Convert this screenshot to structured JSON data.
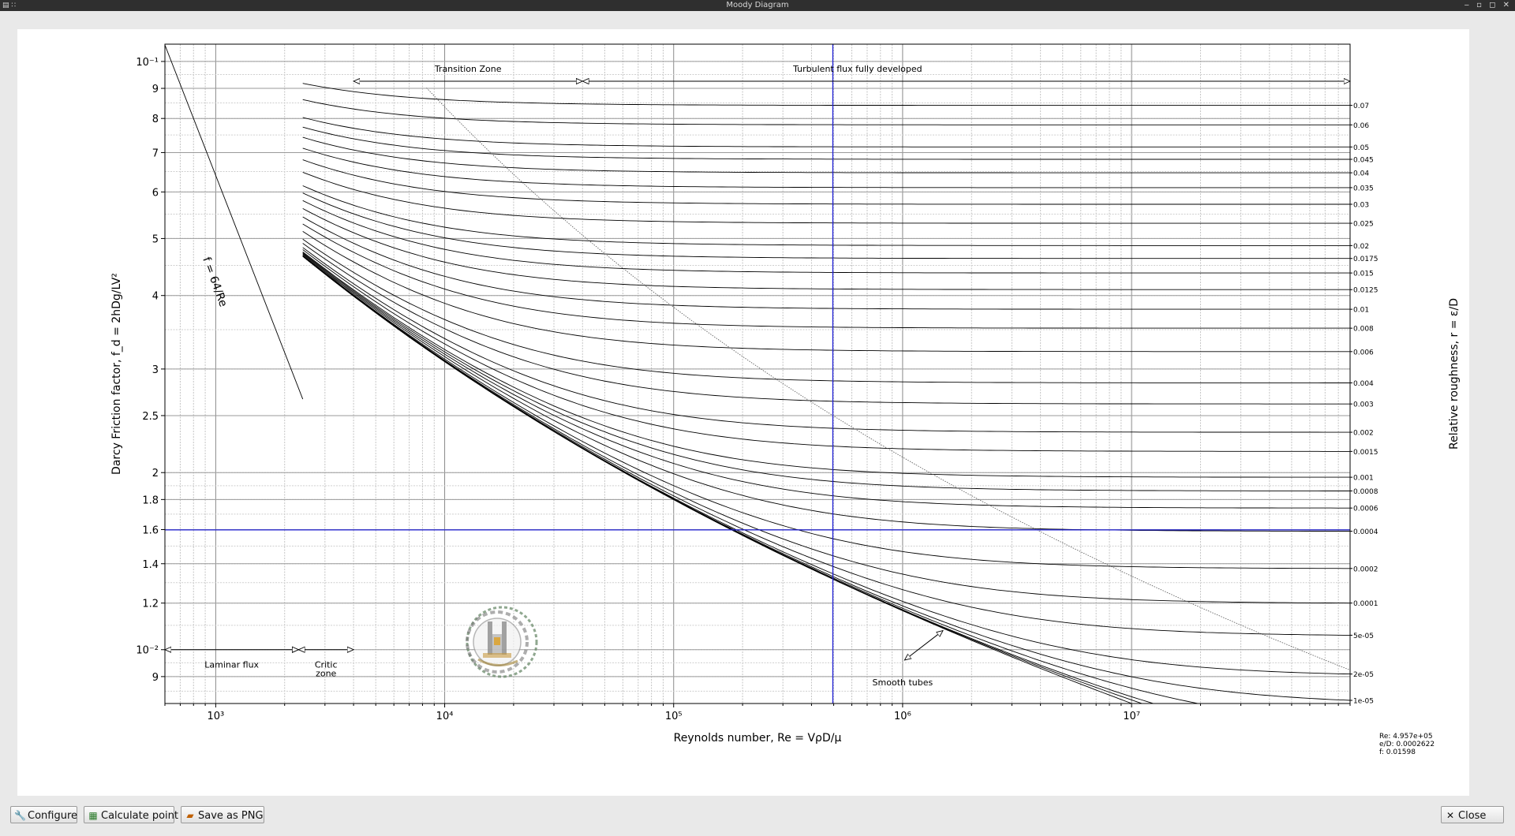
{
  "window": {
    "title": "Moody Diagram"
  },
  "toolbar": {
    "configure_label": "Configure",
    "calculate_label": "Calculate point",
    "save_label": "Save as PNG",
    "close_label": "Close",
    "icons": [
      "wrench-icon",
      "calculator-icon",
      "save-icon",
      "close-icon"
    ]
  },
  "readout": {
    "re": "Re: 4.957e+05",
    "ed": "e/D: 0.0002622",
    "f": "f: 0.01598"
  },
  "chart_data": {
    "type": "line",
    "scale": {
      "x": "log",
      "y": "log"
    },
    "xlim": [
      600,
      90000000
    ],
    "ylim": [
      0.0081,
      0.107
    ],
    "grid": true,
    "xlabel": "Reynolds number, Re = VρD/μ",
    "ylabel": "Darcy Friction factor,  f_d = 2hDg/LV²",
    "y2label": "Relative roughness, r = ε/D",
    "x_ticks": [
      "10³",
      "10⁴",
      "10⁵",
      "10⁶",
      "10⁷"
    ],
    "y_ticks": [
      {
        "v": 0.1,
        "label": "10⁻¹"
      },
      {
        "v": 0.09,
        "label": "9"
      },
      {
        "v": 0.08,
        "label": "8"
      },
      {
        "v": 0.07,
        "label": "7"
      },
      {
        "v": 0.06,
        "label": "6"
      },
      {
        "v": 0.05,
        "label": "5"
      },
      {
        "v": 0.04,
        "label": "4"
      },
      {
        "v": 0.03,
        "label": "3"
      },
      {
        "v": 0.025,
        "label": "2.5"
      },
      {
        "v": 0.02,
        "label": "2"
      },
      {
        "v": 0.018,
        "label": "1.8"
      },
      {
        "v": 0.016,
        "label": "1.6"
      },
      {
        "v": 0.014,
        "label": "1.4"
      },
      {
        "v": 0.012,
        "label": "1.2"
      },
      {
        "v": 0.01,
        "label": "10⁻²"
      },
      {
        "v": 0.009,
        "label": "9"
      }
    ],
    "roughness": [
      0.07,
      0.06,
      0.05,
      0.045,
      0.04,
      0.035,
      0.03,
      0.025,
      0.02,
      0.0175,
      0.015,
      0.0125,
      0.01,
      0.008,
      0.006,
      0.004,
      0.003,
      0.002,
      0.0015,
      0.001,
      0.0008,
      0.0006,
      0.0004,
      0.0002,
      0.0001,
      5e-05,
      2e-05,
      1e-05,
      5e-06,
      2e-06,
      1e-06,
      0
    ],
    "roughness_labels": [
      "0.07",
      "0.06",
      "0.05",
      "0.045",
      "0.04",
      "0.035",
      "0.03",
      "0.025",
      "0.02",
      "0.0175",
      "0.015",
      "0.0125",
      "0.01",
      "0.008",
      "0.006",
      "0.004",
      "0.003",
      "0.002",
      "0.0015",
      "0.001",
      "0.0008",
      "0.0006",
      "0.0004",
      "0.0002",
      "0.0001",
      "5e-05",
      "2e-05",
      "1e-05"
    ],
    "turbulent_re_start": 2400,
    "laminar": {
      "formula": "f = 64/Re",
      "re_range": [
        600,
        2400
      ]
    },
    "zones": {
      "laminar": {
        "label": "Laminar flux",
        "re_range": [
          600,
          2300
        ]
      },
      "critic": {
        "label": "Critic\nzone",
        "re_range": [
          2300,
          4000
        ]
      },
      "transition": {
        "label": "Transition Zone",
        "re_range": [
          4000,
          40000
        ]
      },
      "turbulent": {
        "label": "Turbulent flux fully developed",
        "re_range": [
          40000,
          90000000
        ]
      }
    },
    "annotations": {
      "smooth": "Smooth tubes"
    },
    "selected_point": {
      "re": 495700,
      "f": 0.01598
    }
  }
}
